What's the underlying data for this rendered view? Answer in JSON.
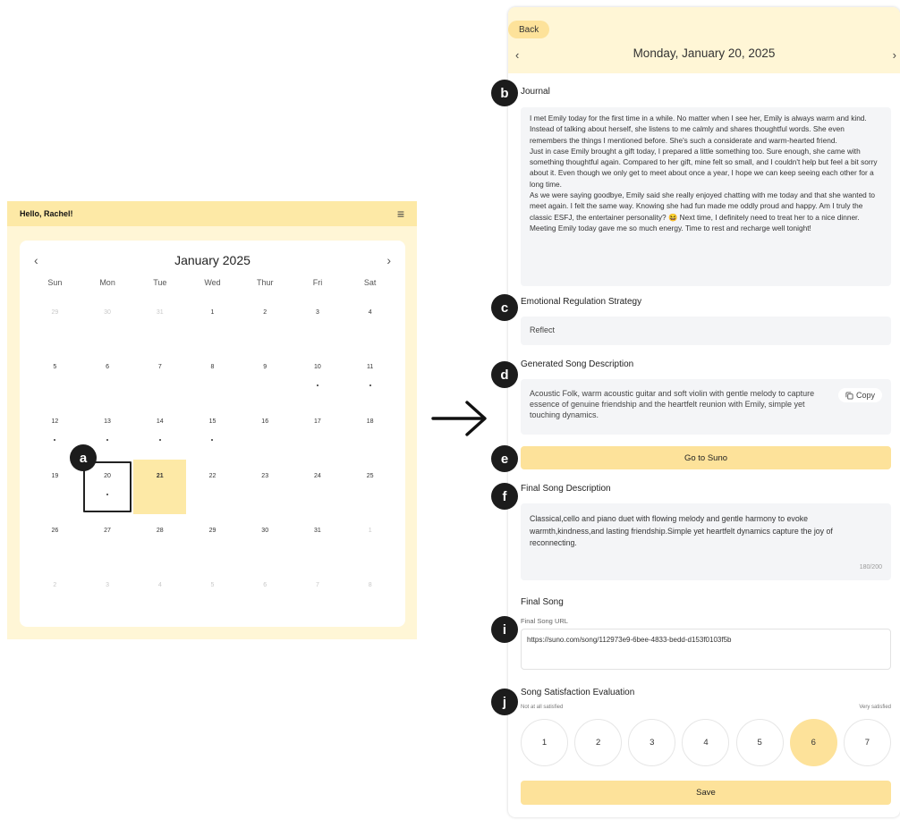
{
  "calendar_screen": {
    "greeting": "Hello, Rachel!",
    "menu_icon": "hamburger-menu-icon",
    "month_title": "January 2025",
    "prev_icon": "‹",
    "next_icon": "›",
    "weekdays": [
      "Sun",
      "Mon",
      "Tue",
      "Wed",
      "Thur",
      "Fri",
      "Sat"
    ],
    "days": [
      {
        "label": "29",
        "muted": true,
        "dot": false
      },
      {
        "label": "30",
        "muted": true,
        "dot": false
      },
      {
        "label": "31",
        "muted": true,
        "dot": false
      },
      {
        "label": "1",
        "muted": false,
        "dot": false
      },
      {
        "label": "2",
        "muted": false,
        "dot": false
      },
      {
        "label": "3",
        "muted": false,
        "dot": false
      },
      {
        "label": "4",
        "muted": false,
        "dot": false
      },
      {
        "label": "5",
        "muted": false,
        "dot": false
      },
      {
        "label": "6",
        "muted": false,
        "dot": false
      },
      {
        "label": "7",
        "muted": false,
        "dot": false
      },
      {
        "label": "8",
        "muted": false,
        "dot": false
      },
      {
        "label": "9",
        "muted": false,
        "dot": false
      },
      {
        "label": "10",
        "muted": false,
        "dot": true
      },
      {
        "label": "11",
        "muted": false,
        "dot": true
      },
      {
        "label": "12",
        "muted": false,
        "dot": true
      },
      {
        "label": "13",
        "muted": false,
        "dot": true
      },
      {
        "label": "14",
        "muted": false,
        "dot": true
      },
      {
        "label": "15",
        "muted": false,
        "dot": true
      },
      {
        "label": "16",
        "muted": false,
        "dot": false
      },
      {
        "label": "17",
        "muted": false,
        "dot": false
      },
      {
        "label": "18",
        "muted": false,
        "dot": false
      },
      {
        "label": "19",
        "muted": false,
        "dot": false
      },
      {
        "label": "20",
        "muted": false,
        "dot": true,
        "selected": true
      },
      {
        "label": "21",
        "muted": false,
        "dot": false,
        "today": true
      },
      {
        "label": "22",
        "muted": false,
        "dot": false
      },
      {
        "label": "23",
        "muted": false,
        "dot": false
      },
      {
        "label": "24",
        "muted": false,
        "dot": false
      },
      {
        "label": "25",
        "muted": false,
        "dot": false
      },
      {
        "label": "26",
        "muted": false,
        "dot": false
      },
      {
        "label": "27",
        "muted": false,
        "dot": false
      },
      {
        "label": "28",
        "muted": false,
        "dot": false
      },
      {
        "label": "29",
        "muted": false,
        "dot": false
      },
      {
        "label": "30",
        "muted": false,
        "dot": false
      },
      {
        "label": "31",
        "muted": false,
        "dot": false
      },
      {
        "label": "1",
        "muted": true,
        "dot": false
      },
      {
        "label": "2",
        "muted": true,
        "dot": false
      },
      {
        "label": "3",
        "muted": true,
        "dot": false
      },
      {
        "label": "4",
        "muted": true,
        "dot": false
      },
      {
        "label": "5",
        "muted": true,
        "dot": false
      },
      {
        "label": "6",
        "muted": true,
        "dot": false
      },
      {
        "label": "7",
        "muted": true,
        "dot": false
      },
      {
        "label": "8",
        "muted": true,
        "dot": false
      }
    ]
  },
  "badges": [
    "a",
    "b",
    "c",
    "d",
    "e",
    "f",
    "i",
    "j"
  ],
  "arrow_icon": "right-arrow-icon",
  "detail_screen": {
    "back_label": "Back",
    "date_title": "Monday, January 20, 2025",
    "prev_icon": "‹",
    "next_icon": "›",
    "journal_label": "Journal",
    "journal_paragraphs": [
      "I met Emily today for the first time in a while. No matter when I see her, Emily is always warm and kind. Instead of talking about herself, she listens to me calmly and shares thoughtful words. She even remembers the things I mentioned before. She's such a considerate and warm-hearted friend.",
      "Just in case Emily brought a gift today, I prepared a little something too. Sure enough, she came with something thoughtful again. Compared to her gift, mine felt so small, and I couldn't help but feel a bit sorry about it. Even though we only get to meet about once a year, I hope we can keep seeing each other for a long time.",
      "As we were saying goodbye, Emily said she really enjoyed chatting with me today and that she wanted to meet again. I felt the same way. Knowing she had fun made me oddly proud and happy. Am I truly the classic ESFJ, the entertainer personality? 😆 Next time, I definitely need to treat her to a nice dinner. Meeting Emily today gave me so much energy. Time to rest and recharge well tonight!"
    ],
    "strategy_label": "Emotional Regulation Strategy",
    "strategy_value": "Reflect",
    "generated_label": "Generated Song Description",
    "generated_text": "Acoustic Folk, warm acoustic guitar and soft violin with gentle melody to capture essence of genuine friendship and the heartfelt reunion with Emily, simple yet touching dynamics.",
    "copy_label": "Copy",
    "copy_icon": "copy-icon",
    "suno_button": "Go to Suno",
    "final_desc_label": "Final Song Description",
    "final_desc_text": "Classical,cello and piano duet with flowing melody and gentle harmony to evoke warmth,kindness,and lasting friendship.Simple yet heartfelt dynamics capture the joy of reconnecting.",
    "char_count": "180/200",
    "final_song_label": "Final Song",
    "url_label": "Final Song URL",
    "url_value": "https://suno.com/song/112973e9-6bee-4833-bedd-d153f0103f5b",
    "satisfaction_label": "Song Satisfaction Evaluation",
    "scale_low": "Not at all satisfied",
    "scale_high": "Very satisfied",
    "ratings": [
      "1",
      "2",
      "3",
      "4",
      "5",
      "6",
      "7"
    ],
    "selected_rating": 6,
    "save_label": "Save"
  },
  "colors": {
    "accent_yellow": "#fde29a",
    "header_yellow": "#fde9a6",
    "panel_cream": "#fff6d6",
    "badge_black": "#1c1c1c"
  }
}
